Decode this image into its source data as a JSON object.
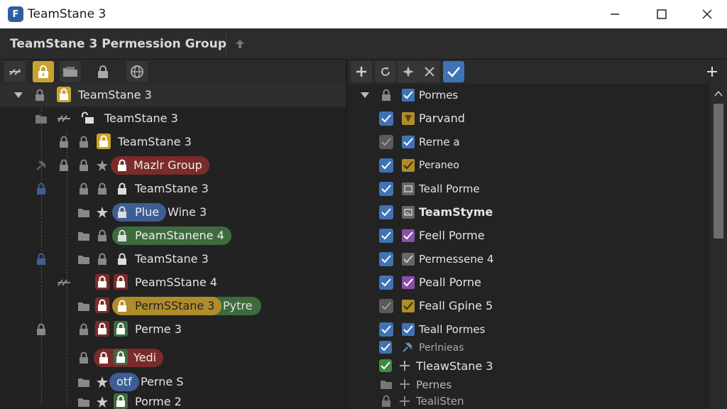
{
  "window": {
    "title": "TeamStane 3",
    "logo_letter": "F"
  },
  "header": {
    "title": "TeamStane 3 Permession Group"
  },
  "tree": {
    "rows": [
      {
        "label": "TeamStane 3"
      },
      {
        "label": "TeamStane 3"
      },
      {
        "label": "TeamStane 3"
      },
      {
        "label": "Mazlr Group"
      },
      {
        "label": "TeamStane 3"
      },
      {
        "label": "Plue",
        "suffix": "Wine 3"
      },
      {
        "label": "PeamStanene 4"
      },
      {
        "label": "TeamStane 3"
      },
      {
        "label": "PeamSStane 4"
      },
      {
        "label": "PermSStane 3",
        "suffix": "Pytre"
      },
      {
        "label": "Perme 3"
      },
      {
        "label": "Yedi"
      },
      {
        "label": "otf",
        "suffix": "Perne S"
      },
      {
        "label": "Porme 2"
      }
    ]
  },
  "permissions": {
    "rows": [
      {
        "label": "Pormes"
      },
      {
        "label": "Parvand"
      },
      {
        "label": "Rerne a"
      },
      {
        "label": "Peraneo"
      },
      {
        "label": "Teall Porme"
      },
      {
        "label": "TeamStyme"
      },
      {
        "label": "Feell Porme"
      },
      {
        "label": "Permessene 4"
      },
      {
        "label": "Peall Porne"
      },
      {
        "label": "Feall Gpine 5"
      },
      {
        "label": "Teall Pormes"
      },
      {
        "label": "Perlnieas"
      },
      {
        "label": "TleawStane 3"
      },
      {
        "label": "Pernes"
      },
      {
        "label": "TealiSten"
      }
    ]
  },
  "colors": {
    "accent_gold": "#c9a32d",
    "accent_blue": "#3f73b5",
    "accent_green": "#3f8a3f",
    "accent_red": "#7c2b2b",
    "accent_purple": "#8a4fa8"
  }
}
